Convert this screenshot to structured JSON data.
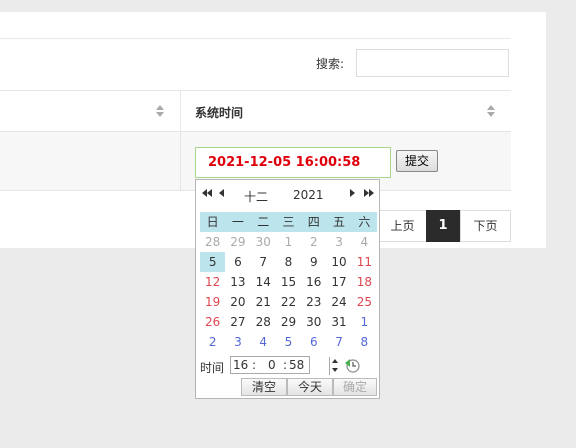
{
  "search": {
    "label": "搜索:",
    "value": "",
    "placeholder": ""
  },
  "table": {
    "columns": [
      "",
      "系统时间"
    ],
    "row": {
      "datetime_value": "2021-12-05 16:00:58",
      "submit_label": "提交"
    }
  },
  "pagination": {
    "prev": "上页",
    "current": "1",
    "next": "下页"
  },
  "calendar": {
    "month": "十二",
    "year": "2021",
    "weekdays": [
      "日",
      "一",
      "二",
      "三",
      "四",
      "五",
      "六"
    ],
    "weeks": [
      [
        "28",
        "29",
        "30",
        "1",
        "2",
        "3",
        "4"
      ],
      [
        "5",
        "6",
        "7",
        "8",
        "9",
        "10",
        "11"
      ],
      [
        "12",
        "13",
        "14",
        "15",
        "16",
        "17",
        "18"
      ],
      [
        "19",
        "20",
        "21",
        "22",
        "23",
        "24",
        "25"
      ],
      [
        "26",
        "27",
        "28",
        "29",
        "30",
        "31",
        "1"
      ],
      [
        "2",
        "3",
        "4",
        "5",
        "6",
        "7",
        "8"
      ]
    ],
    "selected": "5",
    "time_label": "时间",
    "hour": "16",
    "minute": "0",
    "second": "58",
    "time_sep": ":",
    "buttons": {
      "clear": "清空",
      "today": "今天",
      "ok": "确定"
    }
  },
  "colors": {
    "accent_red": "#e0000c",
    "highlight": "#bce4ec",
    "current_page": "#2b2b2b"
  }
}
